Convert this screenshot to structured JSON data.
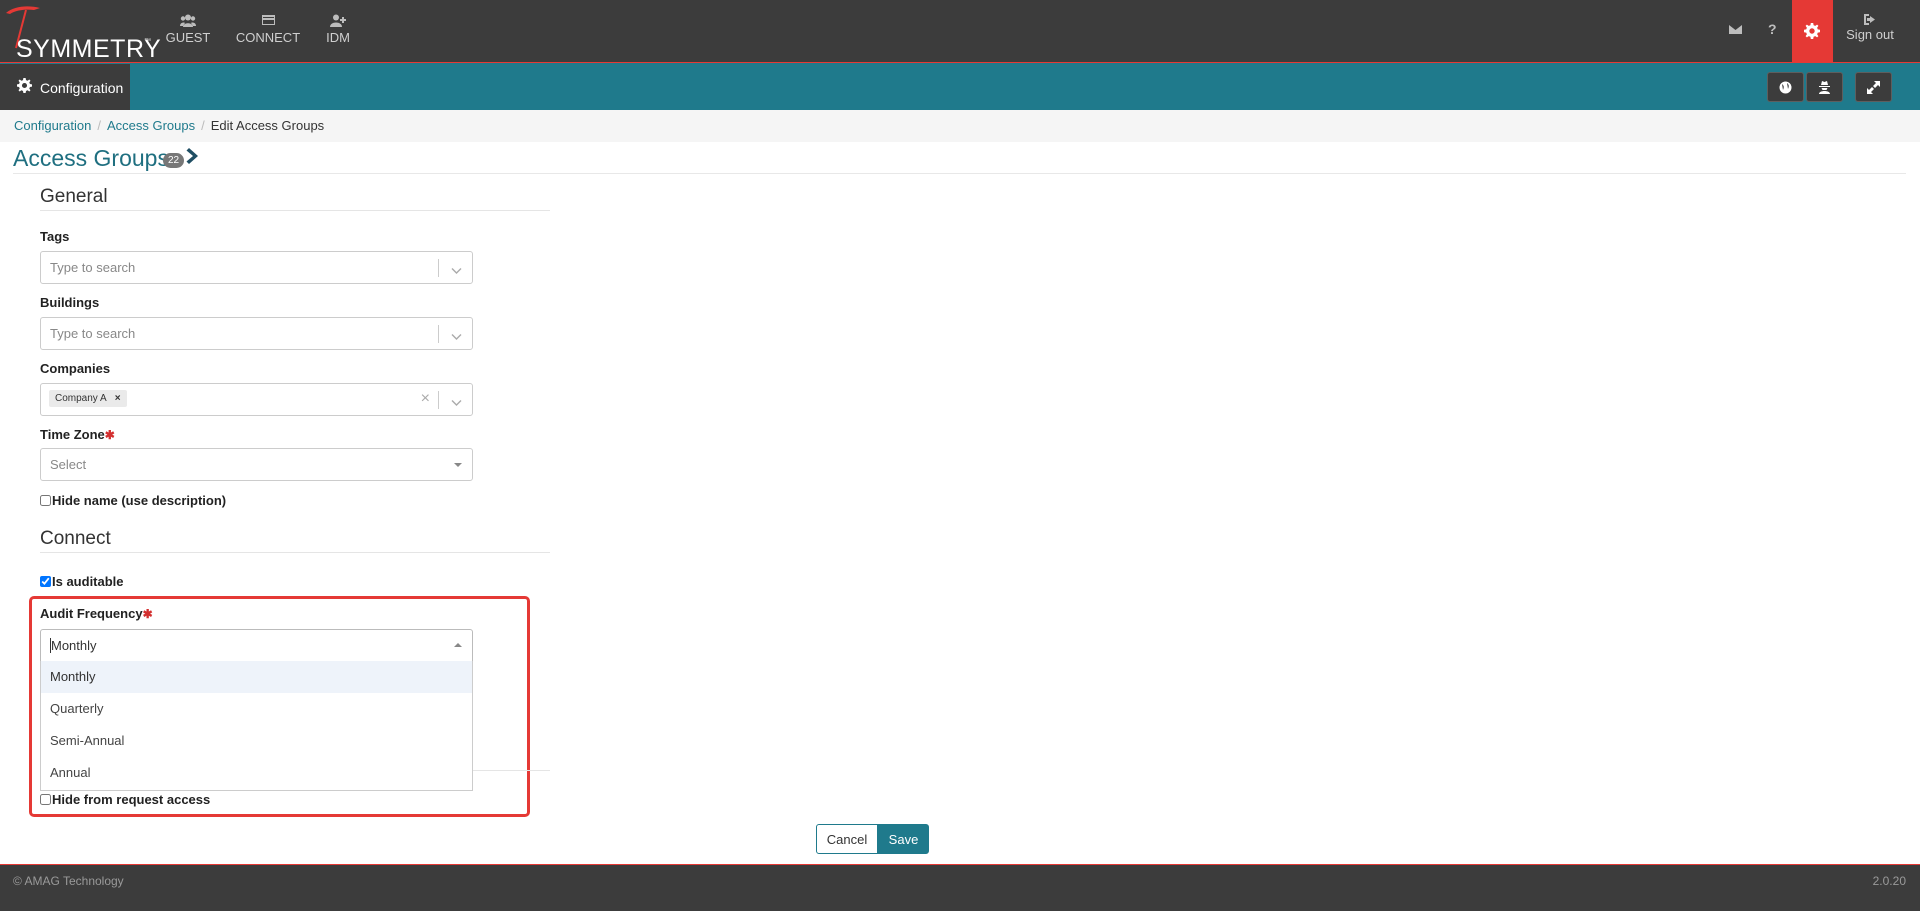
{
  "brand": {
    "logo_text": "SYMMETRY",
    "logo_tm": "™"
  },
  "nav": {
    "items": [
      {
        "label": "GUEST",
        "icon": "users-icon"
      },
      {
        "label": "CONNECT",
        "icon": "credit-card-icon"
      },
      {
        "label": "IDM",
        "icon": "user-plus-icon"
      }
    ],
    "right_icons": [
      "envelope-icon",
      "question-icon",
      "gear-icon"
    ],
    "sign_out": "Sign out"
  },
  "toolbar": {
    "module_label": "Configuration"
  },
  "breadcrumb": {
    "items": [
      "Configuration",
      "Access Groups"
    ],
    "current": "Edit Access Groups"
  },
  "page": {
    "title": "Access Groups",
    "count": "22"
  },
  "general": {
    "heading": "General",
    "tags_label": "Tags",
    "tags_placeholder": "Type to search",
    "buildings_label": "Buildings",
    "buildings_placeholder": "Type to search",
    "companies_label": "Companies",
    "companies_chip": "Company A",
    "chip_remove": "×",
    "clear_symbol": "×",
    "timezone_label": "Time Zone",
    "timezone_placeholder": "Select",
    "required_mark": "✱",
    "hide_name_label": "Hide name (use description)",
    "hide_name_checked": false
  },
  "connect": {
    "heading": "Connect",
    "is_auditable_label": "Is auditable",
    "is_auditable_checked": true,
    "audit_frequency_label": "Audit Frequency",
    "audit_frequency_value": "Monthly",
    "audit_frequency_options": [
      "Monthly",
      "Quarterly",
      "Semi-Annual",
      "Annual"
    ],
    "hide_request_label": "Hide from request access",
    "hide_request_checked": false
  },
  "actions": {
    "cancel": "Cancel",
    "save": "Save"
  },
  "footer": {
    "copyright": "© AMAG Technology",
    "version": "2.0.20"
  },
  "colors": {
    "teal": "#1f7a8c",
    "dark": "#3c3c3c",
    "accent_red": "#e53935"
  }
}
